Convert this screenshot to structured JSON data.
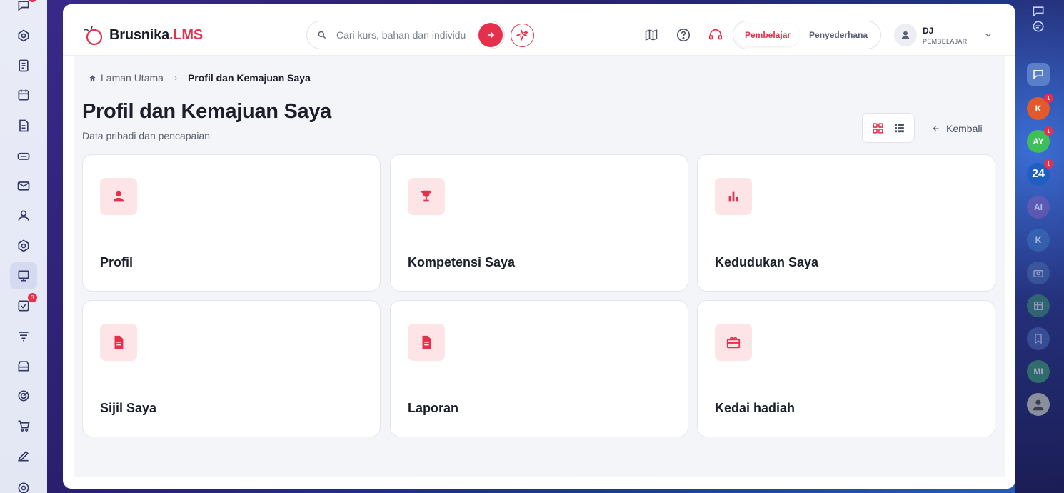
{
  "left_rail": {
    "items": [
      {
        "icon": "chat-icon",
        "badge": "9"
      },
      {
        "icon": "compass-icon"
      },
      {
        "icon": "document-list-icon"
      },
      {
        "icon": "calendar-icon"
      },
      {
        "icon": "file-icon"
      },
      {
        "icon": "drive-icon"
      },
      {
        "icon": "mail-icon"
      },
      {
        "icon": "users-icon"
      },
      {
        "icon": "hexagon-icon"
      },
      {
        "icon": "presentation-icon"
      },
      {
        "icon": "checklist-icon",
        "badge": "3"
      },
      {
        "icon": "filter-icon"
      },
      {
        "icon": "store-icon"
      },
      {
        "icon": "target-icon"
      },
      {
        "icon": "cart-icon"
      },
      {
        "icon": "pen-icon"
      },
      {
        "icon": "settings-icon"
      }
    ]
  },
  "right_rail": {
    "items": [
      {
        "label": "K",
        "color": "#e25a2c",
        "badge": "1"
      },
      {
        "label": "AY",
        "color": "#3fbf5a",
        "badge": "1"
      },
      {
        "label": "24",
        "color": "#1f5fc2",
        "badge": "1"
      },
      {
        "label": "AI",
        "color": "#7a5bb5"
      },
      {
        "label": "K",
        "color": "#3a6fb8"
      },
      {
        "label": "MI",
        "color": "#3c9a6c"
      }
    ]
  },
  "header": {
    "logo_name": "Brusnika",
    "logo_suffix": ".LMS",
    "search_placeholder": "Cari kurs, bahan dan individu",
    "roles": [
      "Pembelajar",
      "Penyederhana"
    ],
    "active_role": "Pembelajar",
    "user_initials": "DJ",
    "user_role": "PEMBELAJAR"
  },
  "breadcrumb": {
    "home": "Laman Utama",
    "current": "Profil dan Kemajuan Saya"
  },
  "page": {
    "title": "Profil dan Kemajuan Saya",
    "subtitle": "Data pribadi dan pencapaian",
    "back_label": "Kembali"
  },
  "tiles": [
    {
      "label": "Profil",
      "icon": "person-icon"
    },
    {
      "label": "Kompetensi Saya",
      "icon": "trophy-icon"
    },
    {
      "label": "Kedudukan Saya",
      "icon": "bar-chart-icon"
    },
    {
      "label": "Sijil Saya",
      "icon": "certificate-icon"
    },
    {
      "label": "Laporan",
      "icon": "report-icon"
    },
    {
      "label": "Kedai hadiah",
      "icon": "gift-icon"
    }
  ],
  "colors": {
    "accent": "#e6304b",
    "accent_soft": "#fde4e7"
  }
}
